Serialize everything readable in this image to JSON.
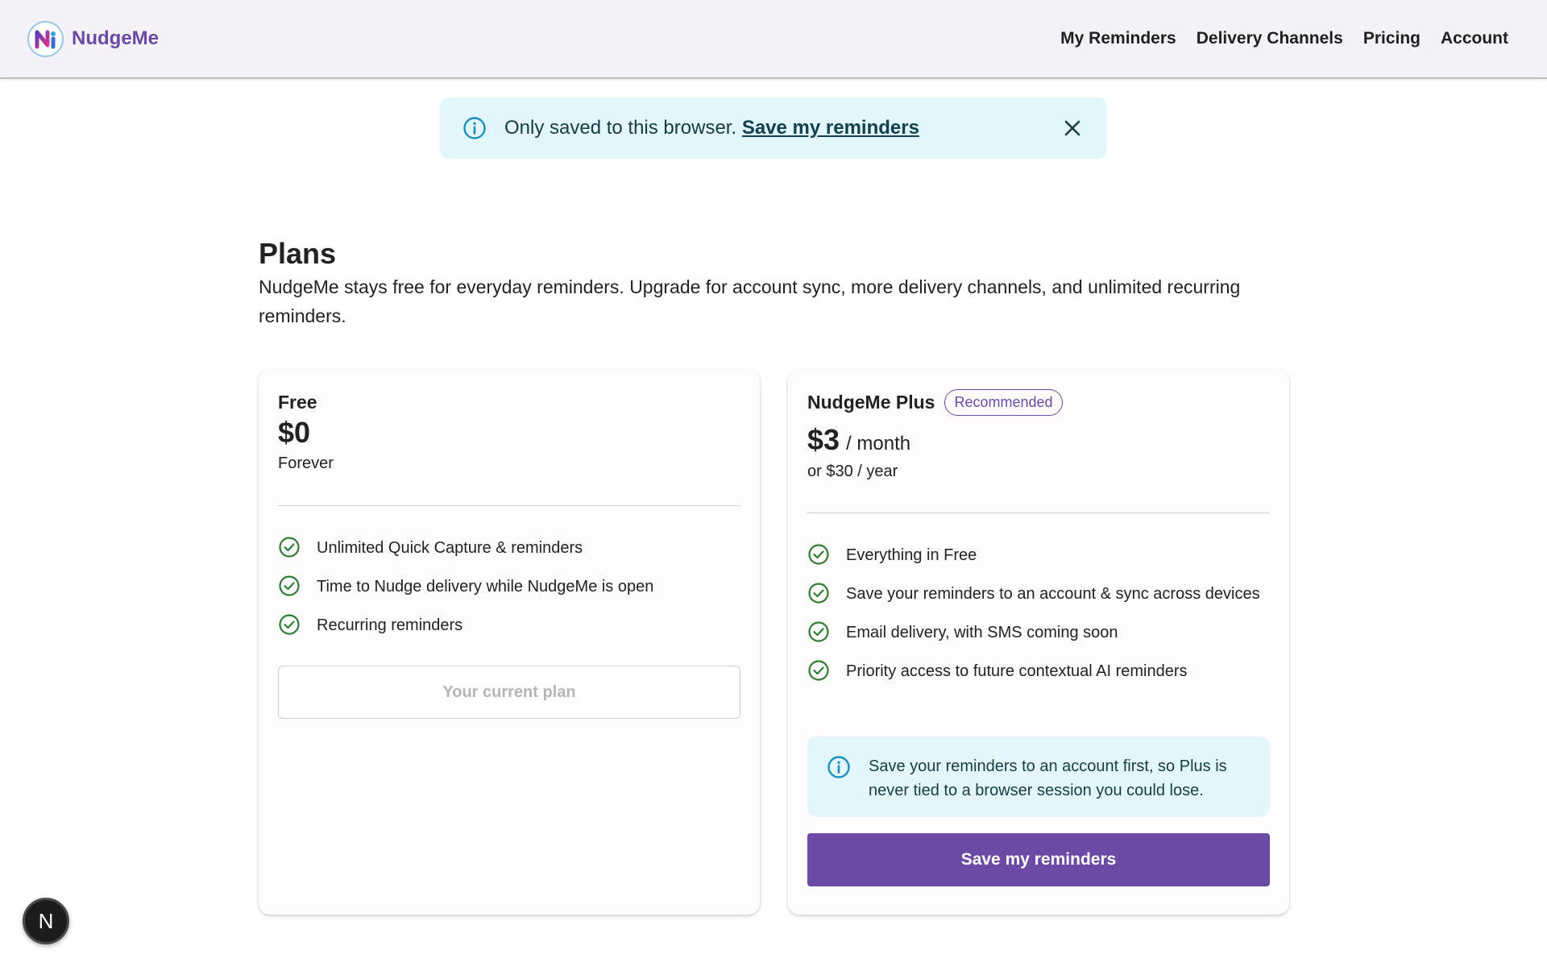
{
  "brand": {
    "name": "NudgeMe"
  },
  "nav": {
    "items": [
      "My Reminders",
      "Delivery Channels",
      "Pricing",
      "Account"
    ]
  },
  "banner": {
    "text": "Only saved to this browser.",
    "link": "Save my reminders",
    "icon": "info-icon",
    "close_icon": "close-icon"
  },
  "plans": {
    "title": "Plans",
    "description": "NudgeMe stays free for everyday reminders. Upgrade for account sync, more delivery channels, and unlimited recurring reminders.",
    "free": {
      "name": "Free",
      "price": "$0",
      "price_sub": "Forever",
      "features": [
        "Unlimited Quick Capture & reminders",
        "Time to Nudge delivery while NudgeMe is open",
        "Recurring reminders"
      ],
      "button": "Your current plan"
    },
    "plus": {
      "name": "NudgeMe Plus",
      "badge": "Recommended",
      "price": "$3",
      "per": "/ month",
      "price_sub": "or $30 / year",
      "features": [
        "Everything in Free",
        "Save your reminders to an account & sync across devices",
        "Email delivery, with SMS coming soon",
        "Priority access to future contextual AI reminders"
      ],
      "notice": "Save your reminders to an account first, so Plus is never tied to a browser session you could lose.",
      "button": "Save my reminders"
    }
  },
  "dev_badge": {
    "letter": "N"
  },
  "colors": {
    "brand": "#6a4aa5",
    "info_bg": "#e2f6fb",
    "info_icon": "#1b8fc4",
    "check": "#2e7d32",
    "header_bg": "#f5f2f7"
  }
}
